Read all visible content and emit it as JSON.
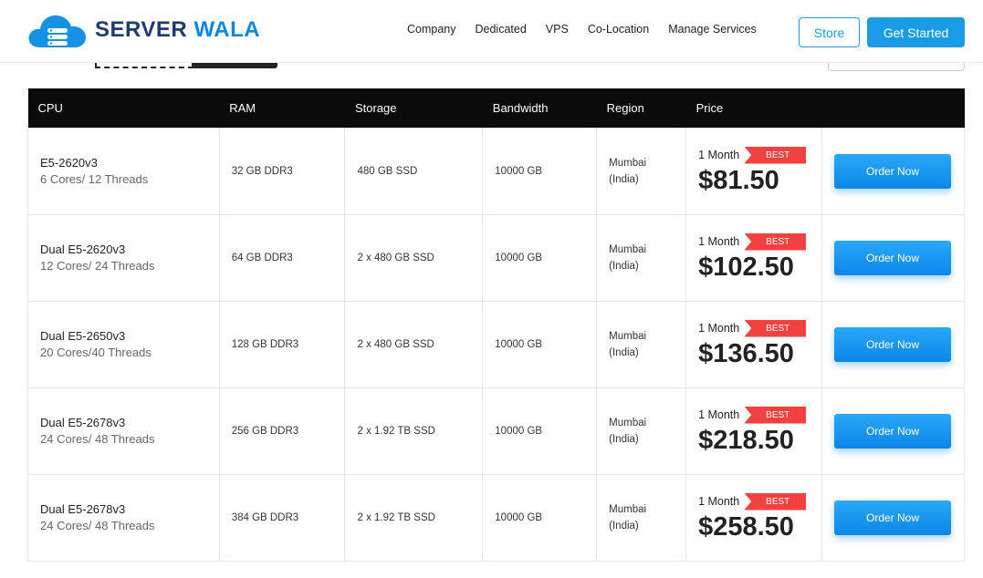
{
  "brand": {
    "name_part1": "SERVER",
    "name_part2": "WALA"
  },
  "nav": {
    "items": [
      "Company",
      "Dedicated",
      "VPS",
      "Co-Location",
      "Manage Services"
    ],
    "store_label": "Store",
    "start_label": "Get Started"
  },
  "colors": {
    "accent": "#1a9be6",
    "badge": "#f34040",
    "header_bg": "#0b0b0b"
  },
  "table": {
    "headers": [
      "CPU",
      "RAM",
      "Storage",
      "Bandwidth",
      "Region",
      "Price",
      ""
    ],
    "rows": [
      {
        "cpu": "E5-2620v3",
        "cores": "6 Cores/ 12 Threads",
        "ram": "32 GB DDR3",
        "storage": "480 GB SSD",
        "bandwidth": "10000 GB",
        "region_line1": "Mumbai",
        "region_line2": "(India)",
        "term": "1 Month",
        "badge": "BEST",
        "price": "$81.50",
        "order": "Order Now"
      },
      {
        "cpu": "Dual E5-2620v3",
        "cores": "12 Cores/ 24 Threads",
        "ram": "64 GB DDR3",
        "storage": "2 x 480 GB SSD",
        "bandwidth": "10000 GB",
        "region_line1": "Mumbai",
        "region_line2": "(India)",
        "term": "1 Month",
        "badge": "BEST",
        "price": "$102.50",
        "order": "Order Now"
      },
      {
        "cpu": "Dual E5-2650v3",
        "cores": "20 Cores/40 Threads",
        "ram": "128 GB DDR3",
        "storage": "2 x 480 GB SSD",
        "bandwidth": "10000 GB",
        "region_line1": "Mumbai",
        "region_line2": "(India)",
        "term": "1 Month",
        "badge": "BEST",
        "price": "$136.50",
        "order": "Order Now"
      },
      {
        "cpu": "Dual E5-2678v3",
        "cores": "24 Cores/ 48 Threads",
        "ram": "256 GB DDR3",
        "storage": "2 x 1.92 TB SSD",
        "bandwidth": "10000 GB",
        "region_line1": "Mumbai",
        "region_line2": "(India)",
        "term": "1 Month",
        "badge": "BEST",
        "price": "$218.50",
        "order": "Order Now"
      },
      {
        "cpu": "Dual E5-2678v3",
        "cores": "24 Cores/ 48 Threads",
        "ram": "384 GB DDR3",
        "storage": "2 x 1.92 TB SSD",
        "bandwidth": "10000 GB",
        "region_line1": "Mumbai",
        "region_line2": "(India)",
        "term": "1 Month",
        "badge": "BEST",
        "price": "$258.50",
        "order": "Order Now"
      }
    ]
  }
}
